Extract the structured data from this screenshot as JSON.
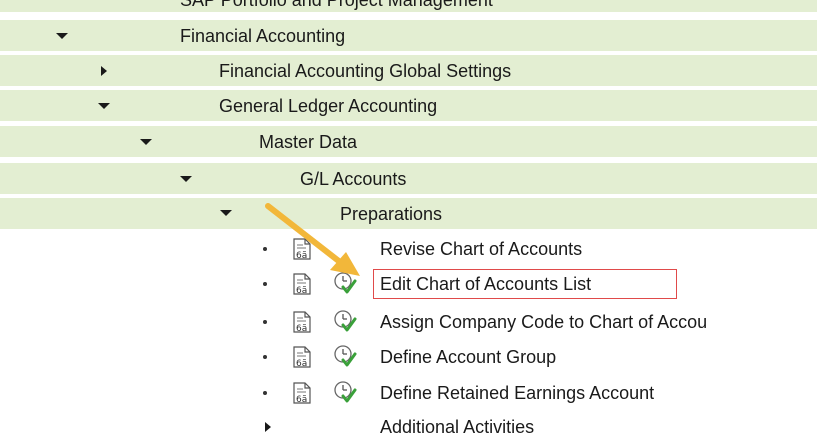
{
  "tree": {
    "items": [
      {
        "label": "SAP Portfolio and Project Management"
      },
      {
        "label": "Financial Accounting"
      },
      {
        "label": "Financial Accounting Global Settings"
      },
      {
        "label": "General Ledger Accounting"
      },
      {
        "label": "Master Data"
      },
      {
        "label": "G/L Accounts"
      },
      {
        "label": "Preparations"
      },
      {
        "label": "Revise Chart of Accounts"
      },
      {
        "label": "Edit Chart of Accounts List"
      },
      {
        "label": "Assign Company Code to Chart of Accou"
      },
      {
        "label": "Define Account Group"
      },
      {
        "label": "Define Retained Earnings Account"
      },
      {
        "label": "Additional Activities"
      }
    ]
  },
  "colors": {
    "row_highlight": "#e3eed2",
    "selection_border": "#e04a4a",
    "annotation_arrow": "#f2b73a",
    "check": "#3aa03a"
  },
  "icons": {
    "document": "document-glasses-icon",
    "execute": "clock-check-icon"
  }
}
